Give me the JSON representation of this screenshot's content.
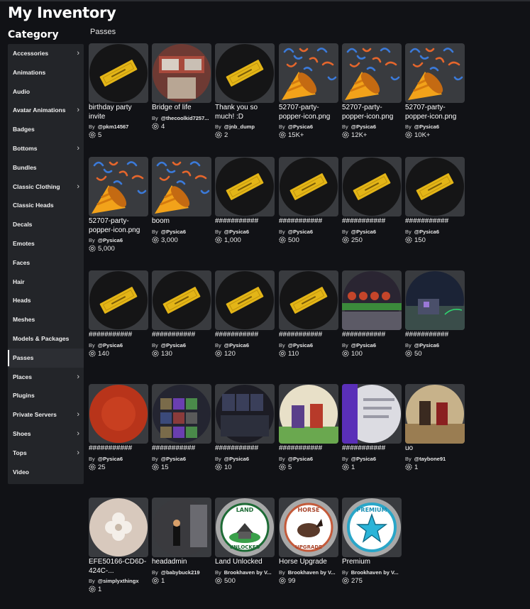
{
  "page": {
    "title": "My Inventory",
    "category_heading": "Category",
    "section_label": "Passes"
  },
  "sidebar": {
    "items": [
      {
        "label": "Accessories",
        "chevron": true
      },
      {
        "label": "Animations",
        "chevron": false
      },
      {
        "label": "Audio",
        "chevron": false
      },
      {
        "label": "Avatar Animations",
        "chevron": true
      },
      {
        "label": "Badges",
        "chevron": false
      },
      {
        "label": "Bottoms",
        "chevron": true
      },
      {
        "label": "Bundles",
        "chevron": false
      },
      {
        "label": "Classic Clothing",
        "chevron": true
      },
      {
        "label": "Classic Heads",
        "chevron": false
      },
      {
        "label": "Decals",
        "chevron": false
      },
      {
        "label": "Emotes",
        "chevron": false
      },
      {
        "label": "Faces",
        "chevron": false
      },
      {
        "label": "Hair",
        "chevron": false
      },
      {
        "label": "Heads",
        "chevron": false
      },
      {
        "label": "Meshes",
        "chevron": false
      },
      {
        "label": "Models & Packages",
        "chevron": false
      },
      {
        "label": "Passes",
        "chevron": false,
        "active": true
      },
      {
        "label": "Places",
        "chevron": true
      },
      {
        "label": "Plugins",
        "chevron": false
      },
      {
        "label": "Private Servers",
        "chevron": true
      },
      {
        "label": "Shoes",
        "chevron": true
      },
      {
        "label": "Tops",
        "chevron": true
      },
      {
        "label": "Video",
        "chevron": false
      }
    ],
    "chevron_glyph": "›"
  },
  "items": [
    {
      "name": "birthday party invite",
      "by": "By",
      "creator": "@pkm14567",
      "count": "5",
      "thumb": "ticket-dark-icon"
    },
    {
      "name": "Bridge of life",
      "by": "By",
      "creator": "@thecoolkid7257...",
      "count": "4",
      "thumb": "bridge-photo"
    },
    {
      "name": "Thank you so much! :D",
      "by": "By",
      "creator": "@jnb_dump",
      "count": "2",
      "thumb": "ticket-dark-icon"
    },
    {
      "name": "52707-party-popper-icon.png",
      "by": "By",
      "creator": "@Pysica6",
      "count": "15K+",
      "thumb": "party-popper-icon"
    },
    {
      "name": "52707-party-popper-icon.png",
      "by": "By",
      "creator": "@Pysica6",
      "count": "12K+",
      "thumb": "party-popper-icon"
    },
    {
      "name": "52707-party-popper-icon.png",
      "by": "By",
      "creator": "@Pysica6",
      "count": "10K+",
      "thumb": "party-popper-icon"
    },
    {
      "name": "52707-party-popper-icon.png",
      "by": "By",
      "creator": "@Pysica6",
      "count": "5,000",
      "thumb": "party-popper-icon"
    },
    {
      "name": "boom",
      "by": "By",
      "creator": "@Pysica6",
      "count": "3,000",
      "thumb": "party-popper-icon"
    },
    {
      "name": "###########",
      "by": "By",
      "creator": "@Pysica6",
      "count": "1,000",
      "thumb": "ticket-dark-icon"
    },
    {
      "name": "###########",
      "by": "By",
      "creator": "@Pysica6",
      "count": "500",
      "thumb": "ticket-dark-icon"
    },
    {
      "name": "###########",
      "by": "By",
      "creator": "@Pysica6",
      "count": "250",
      "thumb": "ticket-dark-icon"
    },
    {
      "name": "###########",
      "by": "By",
      "creator": "@Pysica6",
      "count": "150",
      "thumb": "ticket-dark-icon"
    },
    {
      "name": "###########",
      "by": "By",
      "creator": "@Pysica6",
      "count": "140",
      "thumb": "ticket-dark-icon"
    },
    {
      "name": "###########",
      "by": "By",
      "creator": "@Pysica6",
      "count": "130",
      "thumb": "ticket-dark-icon"
    },
    {
      "name": "###########",
      "by": "By",
      "creator": "@Pysica6",
      "count": "120",
      "thumb": "ticket-dark-icon"
    },
    {
      "name": "###########",
      "by": "By",
      "creator": "@Pysica6",
      "count": "110",
      "thumb": "ticket-dark-icon"
    },
    {
      "name": "###########",
      "by": "By",
      "creator": "@Pysica6",
      "count": "100",
      "thumb": "game-screenshot-lava"
    },
    {
      "name": "###########",
      "by": "By",
      "creator": "@Pysica6",
      "count": "50",
      "thumb": "game-screenshot-night"
    },
    {
      "name": "###########",
      "by": "By",
      "creator": "@Pysica6",
      "count": "25",
      "thumb": "red-blur"
    },
    {
      "name": "###########",
      "by": "By",
      "creator": "@Pysica6",
      "count": "15",
      "thumb": "inventory-screenshot"
    },
    {
      "name": "###########",
      "by": "By",
      "creator": "@Pysica6",
      "count": "10",
      "thumb": "game-ui-screenshot"
    },
    {
      "name": "###########",
      "by": "By",
      "creator": "@Pysica6",
      "count": "5",
      "thumb": "avatars-screenshot"
    },
    {
      "name": "###########",
      "by": "By",
      "creator": "@Pysica6",
      "count": "1",
      "thumb": "phone-screenshot"
    },
    {
      "name": "uo",
      "by": "By",
      "creator": "@taybone91",
      "count": "1",
      "thumb": "avatars-group"
    },
    {
      "name": "EFE50166-CD6D-424C-...",
      "by": "By",
      "creator": "@simplyxthingx",
      "count": "1",
      "thumb": "flower-art"
    },
    {
      "name": "headadmin",
      "by": "By",
      "creator": "@babybuck219",
      "count": "1",
      "thumb": "hallway-avatar"
    },
    {
      "name": "Land Unlocked",
      "by": "By",
      "creator": "Brookhaven by V...",
      "count": "500",
      "thumb": "land-unlocked-badge"
    },
    {
      "name": "Horse Upgrade",
      "by": "By",
      "creator": "Brookhaven by V...",
      "count": "99",
      "thumb": "horse-upgrade-badge"
    },
    {
      "name": "Premium",
      "by": "By",
      "creator": "Brookhaven by V...",
      "count": "275",
      "thumb": "premium-star-badge"
    }
  ],
  "badge_text": {
    "land_top": "LAND",
    "land_bottom": "UNLOCKED",
    "horse_top": "HORSE",
    "horse_bottom": "UPGRADE",
    "premium_top": "PREMIUM"
  },
  "colors": {
    "background": "#111216",
    "sidebar": "#232529",
    "card": "#393b3f",
    "ticket": "#e3b517",
    "accent_active": "#ffffff"
  }
}
